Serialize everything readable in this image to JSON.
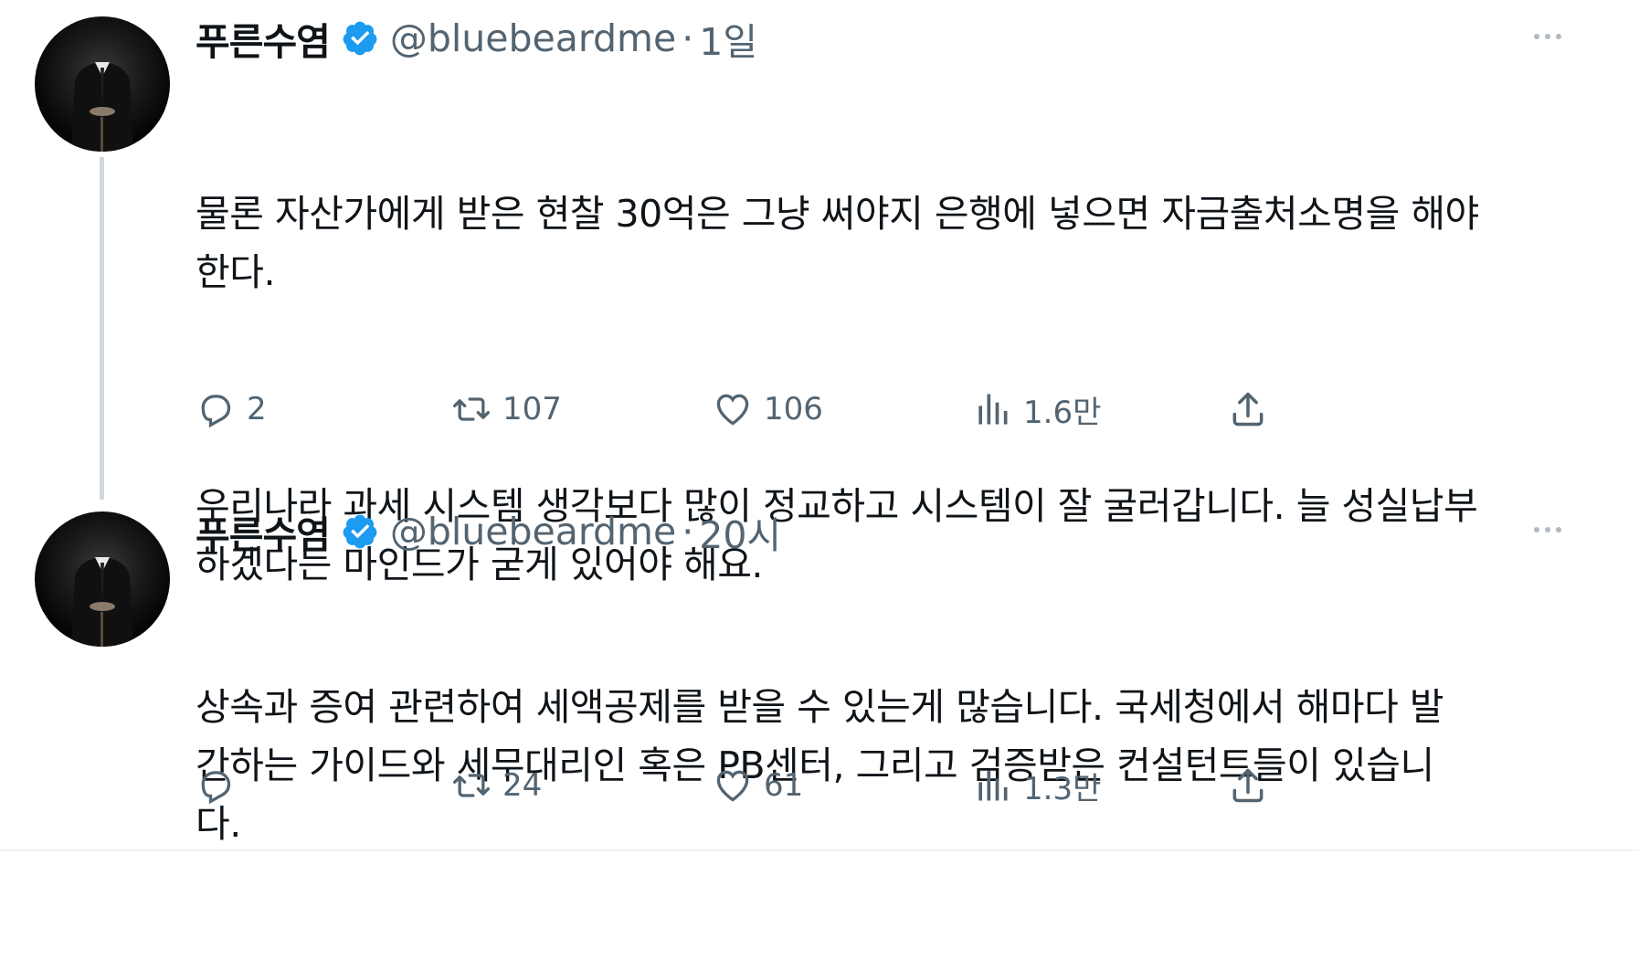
{
  "colors": {
    "text_primary": "#0f1419",
    "text_secondary": "#536471",
    "verified_blue": "#1d9bf0",
    "thread_line": "#cfd9de"
  },
  "tweets": [
    {
      "display_name": "푸른수염",
      "handle": "@bluebeardme",
      "separator": "·",
      "time": "1일",
      "paragraphs": [
        "물론 자산가에게 받은 현찰 30억은 그냥 써야지 은행에 넣으면 자금출처소명을 해야\n한다.",
        "우리나라 과세 시스템 생각보다 많이 정교하고 시스템이 잘 굴러갑니다. 늘 성실납부\n하겠다는 마인드가 굳게 있어야 해요."
      ],
      "replies": "2",
      "retweets": "107",
      "likes": "106",
      "views": "1.6만"
    },
    {
      "display_name": "푸른수염",
      "handle": "@bluebeardme",
      "separator": "·",
      "time": "20시",
      "paragraphs": [
        "상속과 증여 관련하여 세액공제를 받을 수 있는게 많습니다. 국세청에서 해마다 발\n간하는 가이드와 세무대리인 혹은 PB센터, 그리고 검증받은 컨설턴트들이 있습니\n다."
      ],
      "replies": "",
      "retweets": "24",
      "likes": "61",
      "views": "1.3만"
    }
  ],
  "icons": {
    "verified": "verified-badge-icon",
    "more": "more-horizontal-icon",
    "reply": "reply-icon",
    "retweet": "retweet-icon",
    "like": "heart-icon",
    "views": "views-chart-icon",
    "share": "share-icon"
  }
}
